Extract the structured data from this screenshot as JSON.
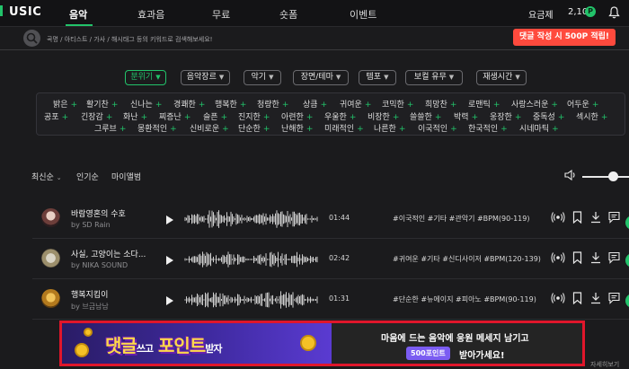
{
  "header": {
    "logo": "USIC",
    "nav": [
      "음악",
      "효과음",
      "무료",
      "숏폼",
      "이벤트"
    ],
    "pricing_label": "요금제",
    "points": "2,100",
    "points_badge": "P"
  },
  "search": {
    "placeholder": "곡명 / 아티스트 / 가사 / 해시태그 등의 키워드로 검색해보세요!",
    "promo": "댓글 작성 시 500P 적립!"
  },
  "filters": [
    "분위기",
    "음악장르",
    "악기",
    "장면/테마",
    "템포",
    "보컬 유무",
    "재생시간"
  ],
  "mood_tags": [
    [
      "밝은",
      "활기찬",
      "신나는",
      "경쾌한",
      "행복한",
      "청량한",
      "상큼",
      "귀여운",
      "코믹한",
      "희망찬",
      "로맨틱",
      "사랑스러운",
      "어두운"
    ],
    [
      "공포",
      "긴장감",
      "화난",
      "찌증난",
      "슬픈",
      "진지한",
      "아련한",
      "우울한",
      "비장한",
      "쓸쓸한",
      "박력",
      "웅장한",
      "중독성",
      "섹시한"
    ],
    [
      "그루브",
      "몽환적인",
      "신비로운",
      "단순한",
      "난해한",
      "미래적인",
      "나른한",
      "이국적인",
      "한국적인",
      "시네마틱"
    ]
  ],
  "sort": [
    "최신순",
    "인기순",
    "마이앨범"
  ],
  "tracks": [
    {
      "title": "바람영혼의 수호",
      "artist": "by SD Rain",
      "duration": "01:44",
      "tags": "#이국적인 #기타 #관악기 #BPM(90-119)"
    },
    {
      "title": "사실, 고양이는 소다...",
      "artist": "by NIKA SOUND",
      "duration": "02:42",
      "tags": "#귀여운 #기타 #신디사이저 #BPM(120-139)"
    },
    {
      "title": "행복지킴이",
      "artist": "by 브금남남",
      "duration": "01:31",
      "tags": "#단순한 #뉴에이지 #피아노 #BPM(90-119)"
    }
  ],
  "banner": {
    "title_part1": "댓글",
    "title_small": "쓰고",
    "title_part2": "포인트",
    "title_small2": "받자",
    "line1": "마음에 드는 음악에 응원 메세지 남기고",
    "pill": "500포인트",
    "line2": "받아가세요!"
  },
  "more_label": "자세히보기",
  "colors": {
    "accent": "#22c36a",
    "promo": "#ff4a3d",
    "banner_border": "#e0162b"
  }
}
